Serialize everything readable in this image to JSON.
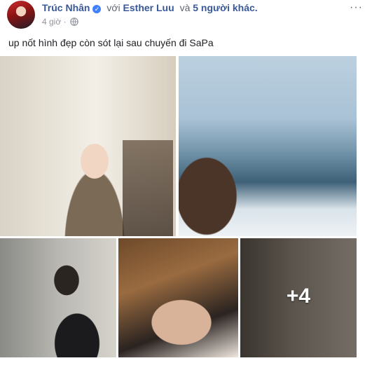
{
  "post": {
    "author": "Trúc Nhân",
    "with_prefix": "với",
    "tagged_name": "Esther Luu",
    "and_text": "và",
    "others": "5 người khác.",
    "time": "4 giờ",
    "dot": "·",
    "more_icon": "···",
    "caption": "up nốt hình đẹp còn sót lại sau chuyến đi SaPa"
  },
  "photos": {
    "more_count": "+4"
  }
}
